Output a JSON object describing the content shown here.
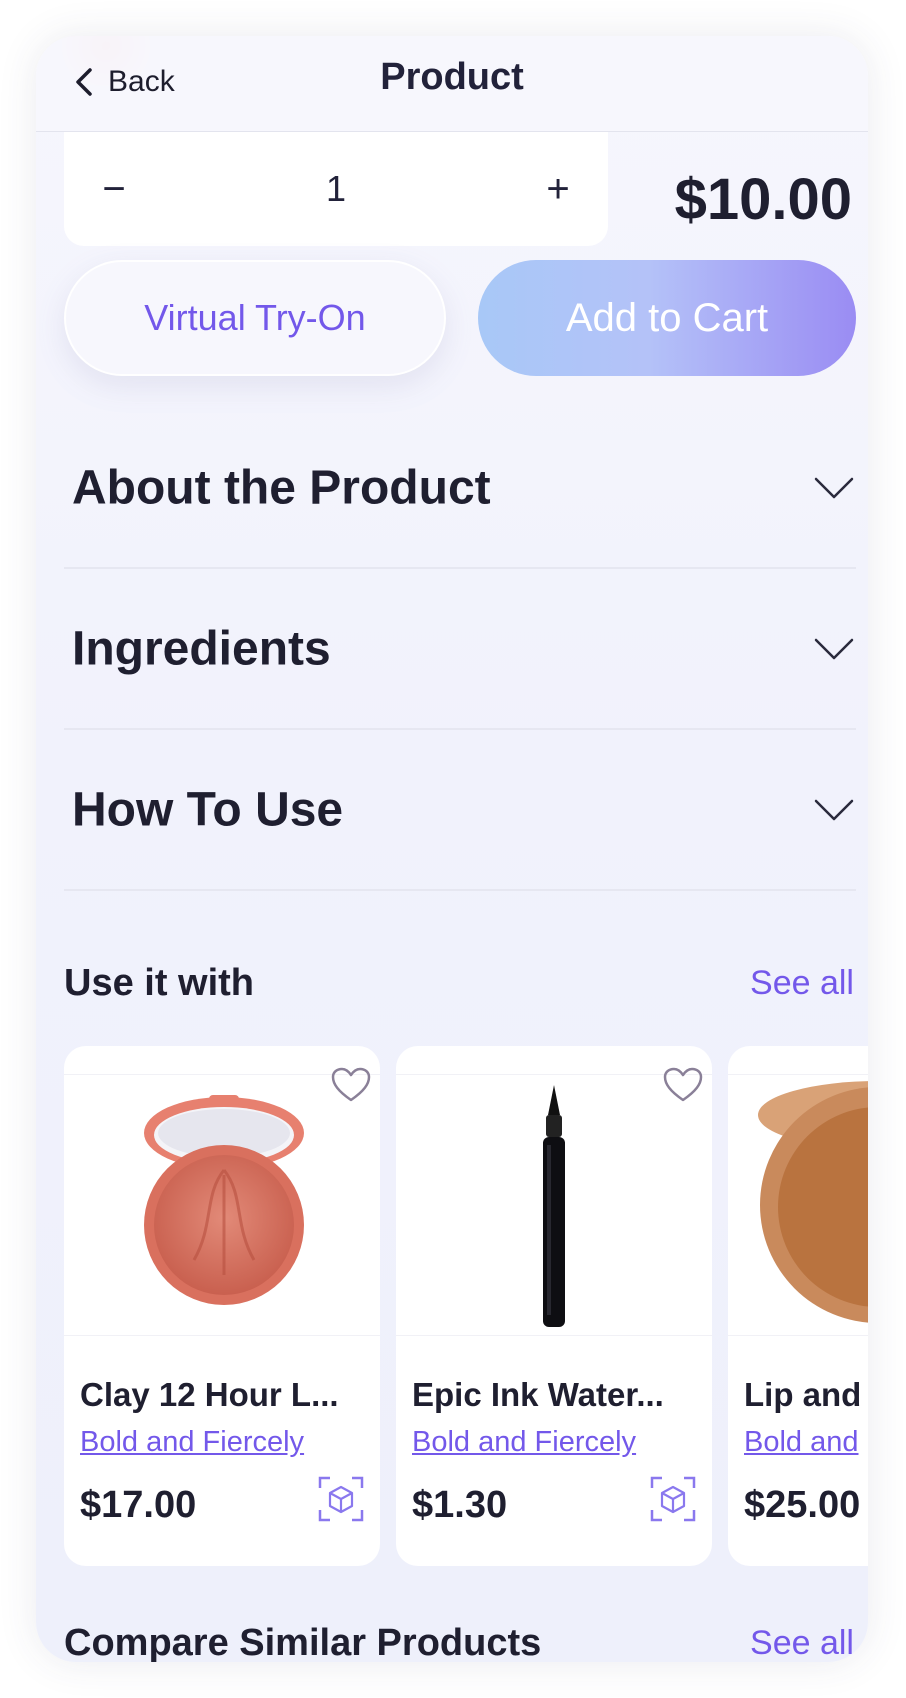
{
  "header": {
    "back_label": "Back",
    "title": "Product"
  },
  "quantity": {
    "minus": "−",
    "value": "1",
    "plus": "+"
  },
  "price": "$10.00",
  "actions": {
    "try_on": "Virtual Try-On",
    "add_to_cart": "Add to Cart"
  },
  "accordion": [
    {
      "label": "About the Product"
    },
    {
      "label": "Ingredients"
    },
    {
      "label": "How To Use"
    }
  ],
  "use_it_with": {
    "title": "Use it with",
    "see_all": "See all",
    "products": [
      {
        "name": "Clay 12 Hour L...",
        "brand": "Bold and Fiercely",
        "price": "$17.00",
        "image_icon": "blush-compact"
      },
      {
        "name": "Epic Ink Water...",
        "brand": "Bold and Fiercely",
        "price": "$1.30",
        "image_icon": "liquid-eyeliner"
      },
      {
        "name": "Lip and",
        "brand": "Bold and",
        "price": "$25.00",
        "image_icon": "bronzer-compact"
      }
    ]
  },
  "compare": {
    "title": "Compare Similar Products",
    "see_all": "See all"
  },
  "colors": {
    "accent": "#7358ea",
    "text": "#1f1f30"
  }
}
